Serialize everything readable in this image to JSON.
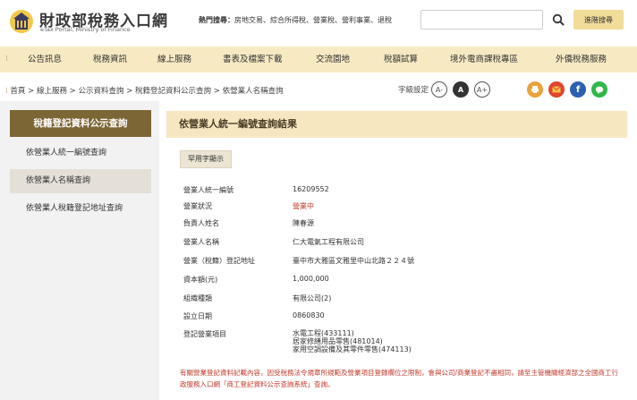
{
  "header": {
    "logo_title": "財政部稅務入口網",
    "logo_subtitle": "eTax Portal, Ministry of Finance",
    "hot_label": "熱門搜尋：",
    "hot_terms": "房地交易、綜合所得稅、營業稅、營利事業、退稅",
    "search_placeholder": "",
    "advanced_search": "進階搜尋"
  },
  "nav": {
    "items": [
      "公告訊息",
      "稅務資訊",
      "線上服務",
      "書表及檔案下載",
      "交流園地",
      "稅額試算",
      "境外電商課稅專區",
      "外僑稅務服務"
    ]
  },
  "breadcrumb": {
    "home": "首頁",
    "sep": " > ",
    "items": [
      "線上服務",
      "公示資料查詢",
      "稅籍登記資料公示查詢",
      "依營業人名稱查詢"
    ]
  },
  "font_size": {
    "label": "字級設定",
    "small": "A-",
    "medium": "A",
    "large": "A+"
  },
  "sidebar": {
    "title": "稅籍登記資料公示查詢",
    "items": [
      "依營業人統一編號查詢",
      "依營業人名稱查詢",
      "依營業人稅籍登記地址查詢"
    ]
  },
  "main": {
    "heading": "依營業人統一編號查詢結果",
    "common_chars_button": "罕用字顯示",
    "fields": [
      {
        "label": "營業人統一編號",
        "value": "16209552"
      },
      {
        "label": "營業狀況",
        "value": "營業中"
      },
      {
        "label": "負責人姓名",
        "value": "陳春源"
      },
      {
        "label": "營業人名稱",
        "value": "仁大電氣工程有限公司"
      },
      {
        "label": "營業（稅籍）登記地址",
        "value": "臺中市大雅區文雅里中山北路２２４號"
      },
      {
        "label": "資本額(元)",
        "value": "1,000,000"
      },
      {
        "label": "組織種類",
        "value": "有限公司(2)"
      },
      {
        "label": "設立日期",
        "value": "0860830"
      },
      {
        "label": "登記營業項目",
        "value": ""
      }
    ],
    "business_items": [
      "水電工程(433111)",
      "居家修繕用品零售(481014)",
      "家用空調設備及其零件零售(474113)"
    ],
    "note_text": "有關營業登記資料記載內容，因受稅務法令規章所規範及營業項目登錄欄位之限制，會與公司/商業登記不盡相同，請至主管機關經濟部之全國商工行政服務入口網「",
    "note_link": "商工登記資料公示查詢系統",
    "note_end": "」查詢。"
  },
  "colors": {
    "nav_bg": "#f7eac3",
    "side_title_bg": "#7d6636",
    "heading_bg": "#f7e7c1",
    "alert": "#c0392b"
  }
}
